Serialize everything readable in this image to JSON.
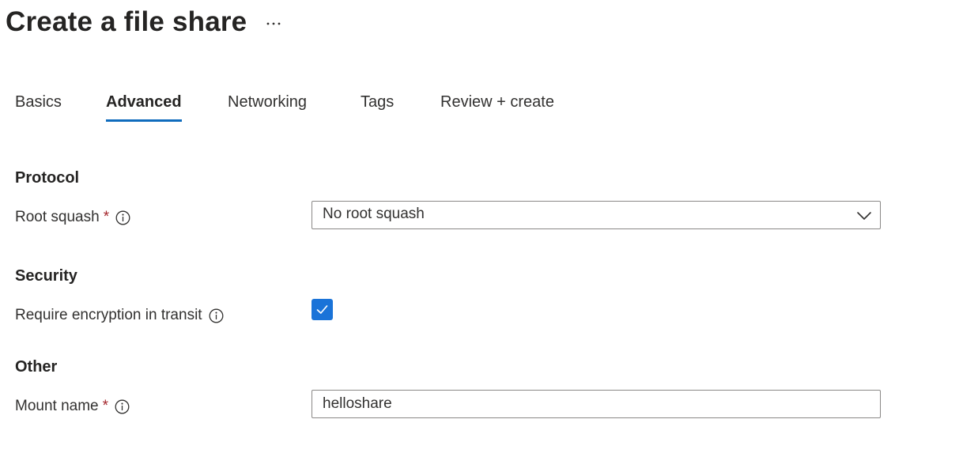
{
  "header": {
    "title": "Create a file share",
    "more_icon": "more-horizontal-icon"
  },
  "tabs": [
    {
      "label": "Basics",
      "active": false
    },
    {
      "label": "Advanced",
      "active": true
    },
    {
      "label": "Networking",
      "active": false
    },
    {
      "label": "Tags",
      "active": false
    },
    {
      "label": "Review + create",
      "active": false
    }
  ],
  "protocol": {
    "heading": "Protocol",
    "root_squash": {
      "label": "Root squash",
      "required_marker": "*",
      "info_icon": "info-icon",
      "selected_value": "No root squash",
      "chevron_icon": "chevron-down-icon"
    }
  },
  "security": {
    "heading": "Security",
    "encryption": {
      "label": "Require encryption in transit",
      "info_icon": "info-icon",
      "checked": true
    }
  },
  "other": {
    "heading": "Other",
    "mount_name": {
      "label": "Mount name",
      "required_marker": "*",
      "info_icon": "info-icon",
      "value": "helloshare"
    }
  },
  "colors": {
    "accent": "#0f6cbd",
    "checkbox_fill": "#1a73d8",
    "required": "#a4262c",
    "text": "#323130",
    "border": "#8a8886"
  }
}
